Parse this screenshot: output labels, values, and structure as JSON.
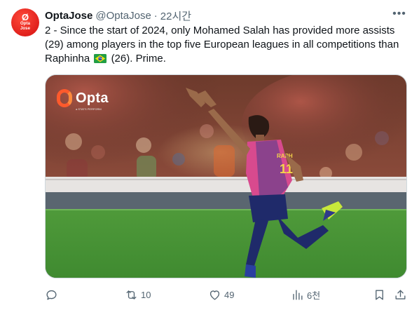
{
  "tweet": {
    "avatar_text": "Opta",
    "avatar_subtext": "Jose",
    "display_name": "OptaJose",
    "handle": "@OptaJose",
    "separator": "·",
    "time": "22시간",
    "more_icon": "more-horizontal-icon",
    "text_before_flag": "2 - Since the start of 2024, only Mohamed Salah has provided more assists (29) among players in the top five European leagues in all competitions than Raphinha",
    "text_after_flag": "(26). Prime.",
    "flag_emoji": "brazil-flag",
    "colors": {
      "link": "#1d9bf0",
      "secondary": "#536471",
      "avatar": "#e0201c"
    }
  },
  "media": {
    "watermark": "Opta",
    "watermark_sub": "a STATS PERFORM",
    "jersey_number": "11"
  },
  "actions": {
    "reply": {
      "icon": "reply-icon",
      "count": ""
    },
    "repost": {
      "icon": "repost-icon",
      "count": "10"
    },
    "like": {
      "icon": "heart-icon",
      "count": "49"
    },
    "views": {
      "icon": "views-icon",
      "count": "6천"
    },
    "bookmark": {
      "icon": "bookmark-icon"
    },
    "share": {
      "icon": "share-icon"
    }
  }
}
